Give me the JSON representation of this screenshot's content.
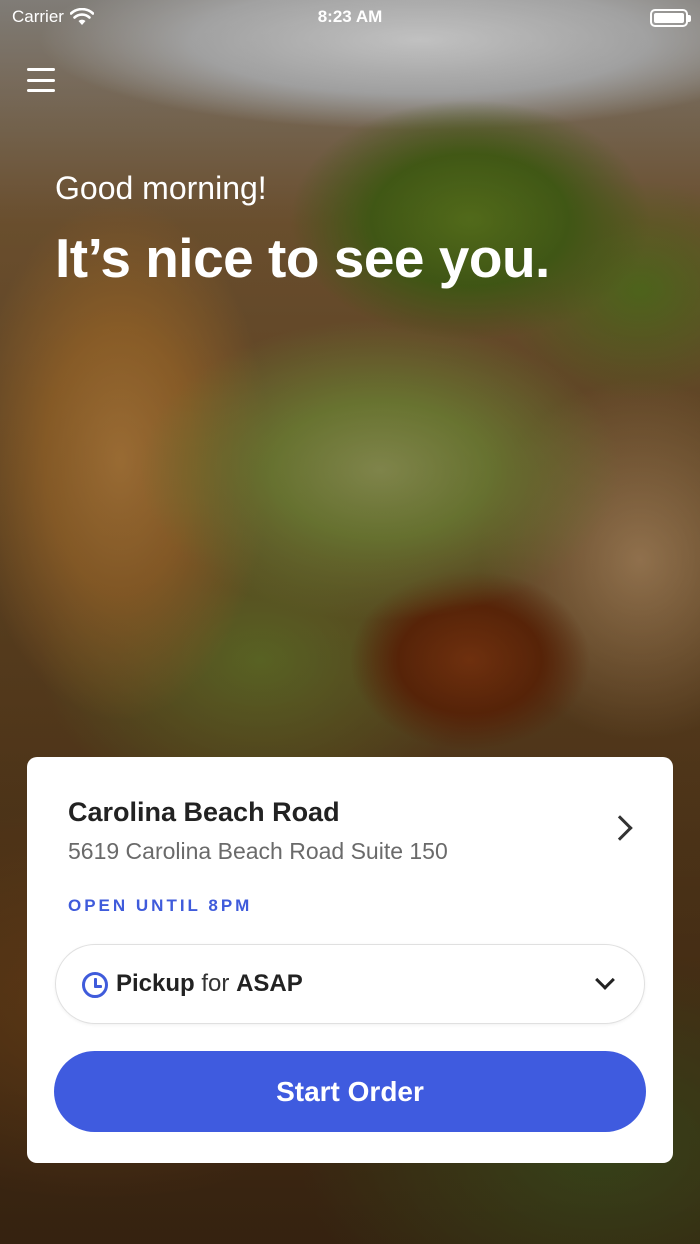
{
  "status_bar": {
    "carrier": "Carrier",
    "time": "8:23 AM"
  },
  "header": {
    "menu_icon": "hamburger-menu-icon",
    "greeting": "Good morning!",
    "headline": "It’s nice to see you."
  },
  "location": {
    "name": "Carolina Beach Road",
    "address": "5619 Carolina Beach Road Suite 150",
    "status": "OPEN UNTIL 8PM"
  },
  "order_mode": {
    "mode": "Pickup",
    "connector": "for",
    "time": "ASAP"
  },
  "actions": {
    "start_order": "Start Order"
  },
  "colors": {
    "accent": "#3f5bdf",
    "card": "#ffffff",
    "text_primary": "#222222",
    "text_secondary": "#6a6a6a"
  }
}
